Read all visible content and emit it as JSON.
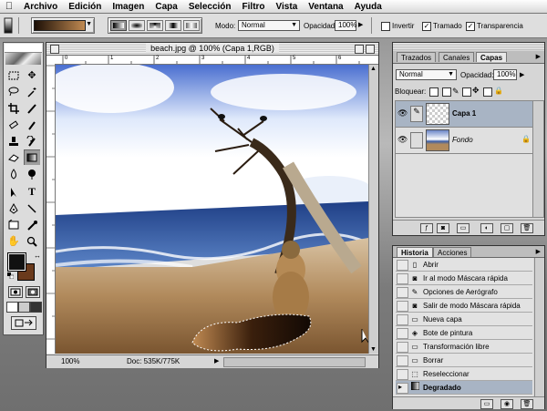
{
  "menubar": {
    "apple_icon": "apple-icon",
    "items": [
      "Archivo",
      "Edición",
      "Imagen",
      "Capa",
      "Selección",
      "Filtro",
      "Vista",
      "Ventana",
      "Ayuda"
    ]
  },
  "options": {
    "mode_label": "Modo:",
    "mode_value": "Normal",
    "opacity_label": "Opacidad:",
    "opacity_value": "100%",
    "invert_label": "Invertir",
    "invert_checked": false,
    "dither_label": "Tramado",
    "dither_checked": true,
    "transparency_label": "Transparencia",
    "transparency_checked": true
  },
  "document": {
    "title": "beach.jpg @ 100% (Capa 1,RGB)",
    "zoom": "100%",
    "doc_info": "Doc: 535K/775K"
  },
  "layers_panel": {
    "tabs": [
      "Trazados",
      "Canales",
      "Capas"
    ],
    "active_tab": "Capas",
    "blend_mode": "Normal",
    "opacity_label": "Opacidad:",
    "opacity_value": "100%",
    "lock_label": "Bloquear:",
    "layers": [
      {
        "name": "Capa 1",
        "selected": true,
        "italic": false
      },
      {
        "name": "Fondo",
        "selected": false,
        "italic": true
      }
    ]
  },
  "history_panel": {
    "tabs": [
      "Historia",
      "Acciones"
    ],
    "active_tab": "Historia",
    "items": [
      {
        "label": "Abrir",
        "icon": "open-icon"
      },
      {
        "label": "Ir al modo Máscara rápida",
        "icon": "quickmask-icon"
      },
      {
        "label": "Opciones de Aerógrafo",
        "icon": "airbrush-icon"
      },
      {
        "label": "Salir de modo Máscara rápida",
        "icon": "quickmask-exit-icon"
      },
      {
        "label": "Nueva capa",
        "icon": "new-layer-icon"
      },
      {
        "label": "Bote de pintura",
        "icon": "paint-bucket-icon"
      },
      {
        "label": "Transformación libre",
        "icon": "transform-icon"
      },
      {
        "label": "Borrar",
        "icon": "erase-icon"
      },
      {
        "label": "Reseleccionar",
        "icon": "reselect-icon"
      },
      {
        "label": "Degradado",
        "icon": "gradient-icon"
      }
    ],
    "selected_index": 9
  },
  "colors": {
    "foreground": "#111111",
    "background": "#6a3a1c",
    "gradient_start": "#1c0f06",
    "gradient_end": "#c08a52"
  }
}
